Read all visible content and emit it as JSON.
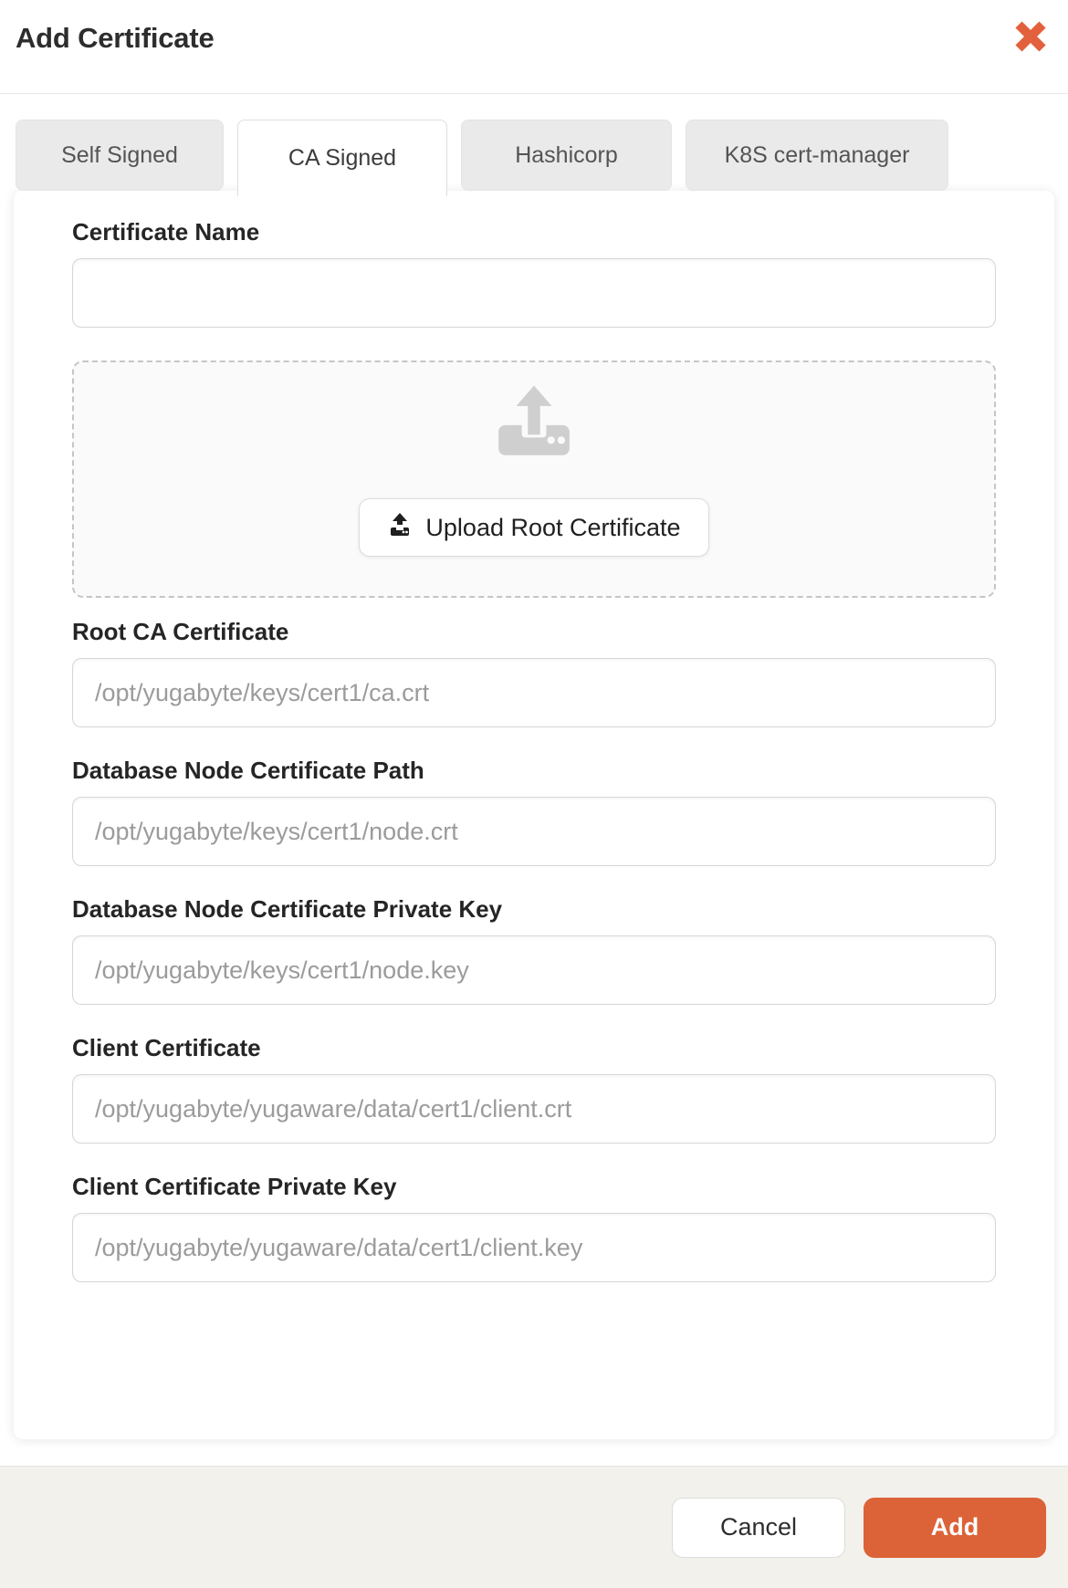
{
  "header": {
    "title": "Add Certificate"
  },
  "tabs": [
    {
      "label": "Self Signed",
      "active": false
    },
    {
      "label": "CA Signed",
      "active": true
    },
    {
      "label": "Hashicorp",
      "active": false
    },
    {
      "label": "K8S cert-manager",
      "active": false
    }
  ],
  "form": {
    "certificate_name": {
      "label": "Certificate Name",
      "value": "",
      "placeholder": ""
    },
    "upload": {
      "button_label": "Upload Root Certificate"
    },
    "fields": [
      {
        "label": "Root CA Certificate",
        "placeholder": "/opt/yugabyte/keys/cert1/ca.crt"
      },
      {
        "label": "Database Node Certificate Path",
        "placeholder": "/opt/yugabyte/keys/cert1/node.crt"
      },
      {
        "label": "Database Node Certificate Private Key",
        "placeholder": "/opt/yugabyte/keys/cert1/node.key"
      },
      {
        "label": "Client Certificate",
        "placeholder": "/opt/yugabyte/yugaware/data/cert1/client.crt"
      },
      {
        "label": "Client Certificate Private Key",
        "placeholder": "/opt/yugabyte/yugaware/data/cert1/client.key"
      }
    ]
  },
  "footer": {
    "cancel_label": "Cancel",
    "add_label": "Add"
  },
  "colors": {
    "accent_orange": "#DC6337",
    "close_icon_orange": "#E2613C",
    "footer_background": "#F2F1EC",
    "tab_inactive_background": "#EAEAEA"
  }
}
